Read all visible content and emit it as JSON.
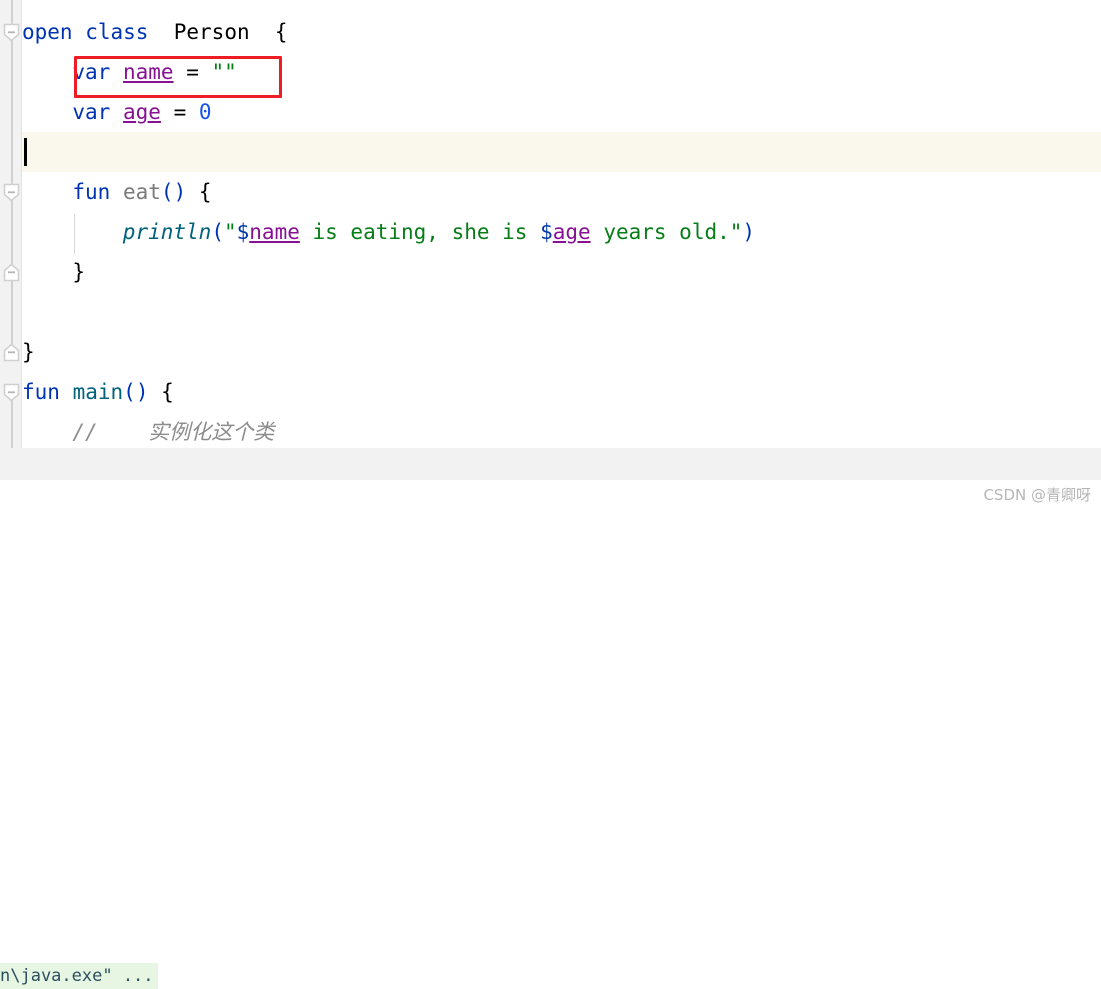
{
  "editor": {
    "language": "Kotlin",
    "colors": {
      "keyword": "#0033b3",
      "property": "#871094",
      "string": "#067d17",
      "number": "#1750eb",
      "function_declaration": "#7a7a7a",
      "function_call": "#00627a",
      "comment": "#8c8c8c",
      "active_line_background": "#faf8ed",
      "gutter_background": "#f2f2f2",
      "annotation_box": "#ee1c25",
      "console_background": "#e7f5e3"
    },
    "lines": [
      {
        "n": 1,
        "indent": 0,
        "tokens": [
          {
            "t": "open",
            "c": "kw"
          },
          {
            "t": " ",
            "c": "plain"
          },
          {
            "t": "class",
            "c": "kw"
          },
          {
            "t": "  ",
            "c": "plain"
          },
          {
            "t": "Person",
            "c": "ident"
          },
          {
            "t": "  ",
            "c": "plain"
          },
          {
            "t": "{",
            "c": "brace"
          }
        ]
      },
      {
        "n": 2,
        "indent": 1,
        "tokens": [
          {
            "t": "var",
            "c": "kw"
          },
          {
            "t": " ",
            "c": "plain"
          },
          {
            "t": "name",
            "c": "prop"
          },
          {
            "t": " = ",
            "c": "plain"
          },
          {
            "t": "\"\"",
            "c": "str"
          }
        ]
      },
      {
        "n": 3,
        "indent": 1,
        "tokens": [
          {
            "t": "var",
            "c": "kw"
          },
          {
            "t": " ",
            "c": "plain"
          },
          {
            "t": "age",
            "c": "prop"
          },
          {
            "t": " = ",
            "c": "plain"
          },
          {
            "t": "0",
            "c": "num"
          }
        ]
      },
      {
        "n": 4,
        "indent": 0,
        "tokens": []
      },
      {
        "n": 5,
        "indent": 1,
        "tokens": [
          {
            "t": "fun",
            "c": "kw"
          },
          {
            "t": " ",
            "c": "plain"
          },
          {
            "t": "eat",
            "c": "fn-decl"
          },
          {
            "t": "()",
            "c": "paren"
          },
          {
            "t": " ",
            "c": "plain"
          },
          {
            "t": "{",
            "c": "brace"
          }
        ]
      },
      {
        "n": 6,
        "indent": 2,
        "tokens": [
          {
            "t": "println",
            "c": "fn-call"
          },
          {
            "t": "(",
            "c": "paren"
          },
          {
            "t": "\"",
            "c": "str"
          },
          {
            "t": "$",
            "c": "dollar"
          },
          {
            "t": "name",
            "c": "prop"
          },
          {
            "t": " is eating, she is ",
            "c": "str"
          },
          {
            "t": "$",
            "c": "dollar"
          },
          {
            "t": "age",
            "c": "prop"
          },
          {
            "t": " years old.\"",
            "c": "str"
          },
          {
            "t": ")",
            "c": "paren"
          }
        ]
      },
      {
        "n": 7,
        "indent": 1,
        "tokens": [
          {
            "t": "}",
            "c": "brace"
          }
        ]
      },
      {
        "n": 8,
        "indent": 0,
        "tokens": []
      },
      {
        "n": 9,
        "indent": 0,
        "tokens": [
          {
            "t": "}",
            "c": "brace"
          }
        ]
      },
      {
        "n": 10,
        "indent": 0,
        "tokens": [
          {
            "t": "fun",
            "c": "kw"
          },
          {
            "t": " ",
            "c": "plain"
          },
          {
            "t": "main",
            "c": "fn-main"
          },
          {
            "t": "()",
            "c": "paren"
          },
          {
            "t": " ",
            "c": "plain"
          },
          {
            "t": "{",
            "c": "brace"
          }
        ]
      },
      {
        "n": 11,
        "indent": 1,
        "tokens": [
          {
            "t": "//    实例化这个类",
            "c": "comment"
          }
        ]
      }
    ],
    "active_line": 4,
    "annotation": {
      "target_line": 2,
      "label": "var name = \"\""
    },
    "fold_markers": [
      {
        "line": 1,
        "type": "collapse"
      },
      {
        "line": 5,
        "type": "collapse"
      },
      {
        "line": 7,
        "type": "expand-end"
      },
      {
        "line": 9,
        "type": "expand-end"
      },
      {
        "line": 10,
        "type": "collapse"
      }
    ]
  },
  "console": {
    "output_text": "n\\java.exe\" ..."
  },
  "watermark": {
    "text": "CSDN @青卿呀"
  }
}
